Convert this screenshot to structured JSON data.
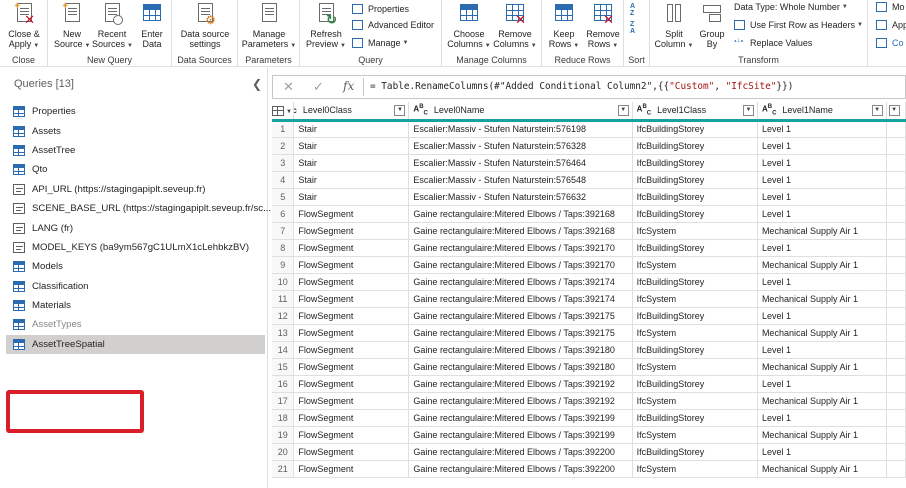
{
  "ribbon": {
    "groups": {
      "close": "Close",
      "new_query": "New Query",
      "data_sources": "Data Sources",
      "parameters": "Parameters",
      "query": "Query",
      "manage_columns": "Manage Columns",
      "reduce_rows": "Reduce Rows",
      "sort": "Sort",
      "transform": "Transform"
    },
    "buttons": {
      "close_apply": [
        "Close &",
        "Apply"
      ],
      "new_source": [
        "New",
        "Source"
      ],
      "recent_sources": [
        "Recent",
        "Sources"
      ],
      "enter_data": [
        "Enter",
        "Data"
      ],
      "data_source_settings": [
        "Data source",
        "settings"
      ],
      "manage_parameters": [
        "Manage",
        "Parameters"
      ],
      "refresh_preview": [
        "Refresh",
        "Preview"
      ],
      "properties": "Properties",
      "advanced_editor": "Advanced Editor",
      "manage": "Manage",
      "choose_columns": [
        "Choose",
        "Columns"
      ],
      "remove_columns": [
        "Remove",
        "Columns"
      ],
      "keep_rows": [
        "Keep",
        "Rows"
      ],
      "remove_rows": [
        "Remove",
        "Rows"
      ],
      "split_column": [
        "Split",
        "Column"
      ],
      "group_by": [
        "Group",
        "By"
      ],
      "data_type": "Data Type: Whole Number",
      "first_row_headers": "Use First Row as Headers",
      "replace_values": "Replace Values",
      "cut_m": "Mo",
      "cut_ap": "App",
      "cut_co": "Co"
    }
  },
  "queries": {
    "header": "Queries [13]",
    "collapse_icon": "chevron-left-icon",
    "items": [
      {
        "label": "Properties",
        "icon": "table-icon"
      },
      {
        "label": "Assets",
        "icon": "table-icon"
      },
      {
        "label": "AssetTree",
        "icon": "table-icon"
      },
      {
        "label": "Qto",
        "icon": "table-icon"
      },
      {
        "label": "API_URL (https://stagingapiplt.seveup.fr)",
        "icon": "parameter-icon"
      },
      {
        "label": "SCENE_BASE_URL (https://stagingapiplt.seveup.fr/sc...",
        "icon": "parameter-icon"
      },
      {
        "label": "LANG (fr)",
        "icon": "parameter-icon"
      },
      {
        "label": "MODEL_KEYS (ba9ym567gC1ULmX1cLehbkzBV)",
        "icon": "parameter-icon"
      },
      {
        "label": "Models",
        "icon": "table-icon"
      },
      {
        "label": "Classification",
        "icon": "table-icon"
      },
      {
        "label": "Materials",
        "icon": "table-icon"
      },
      {
        "label": "AssetTypes",
        "icon": "table-icon"
      },
      {
        "label": "AssetTreeSpatial",
        "icon": "table-icon"
      }
    ],
    "selected": "AssetTreeSpatial"
  },
  "formula_bar": {
    "cancel": "✕",
    "commit": "✓",
    "fx": "fx",
    "prefix": "= Table.RenameColumns(#\"Added Conditional Column2\",{{",
    "arg1": "\"Custom\"",
    "comma": ", ",
    "arg2": "\"IfcSite\"",
    "suffix": "}})"
  },
  "grid": {
    "columns": [
      {
        "name": "Level0Class",
        "type": "ABC"
      },
      {
        "name": "Level0Name",
        "type": "ABC"
      },
      {
        "name": "Level1Class",
        "type": "ABC"
      },
      {
        "name": "Level1Name",
        "type": "ABC"
      }
    ],
    "rows": [
      [
        "1",
        "Stair",
        "Escalier:Massiv - Stufen Naturstein:576198",
        "IfcBuildingStorey",
        "Level 1"
      ],
      [
        "2",
        "Stair",
        "Escalier:Massiv - Stufen Naturstein:576328",
        "IfcBuildingStorey",
        "Level 1"
      ],
      [
        "3",
        "Stair",
        "Escalier:Massiv - Stufen Naturstein:576464",
        "IfcBuildingStorey",
        "Level 1"
      ],
      [
        "4",
        "Stair",
        "Escalier:Massiv - Stufen Naturstein:576548",
        "IfcBuildingStorey",
        "Level 1"
      ],
      [
        "5",
        "Stair",
        "Escalier:Massiv - Stufen Naturstein:576632",
        "IfcBuildingStorey",
        "Level 1"
      ],
      [
        "6",
        "FlowSegment",
        "Gaine rectangulaire:Mitered Elbows / Taps:392168",
        "IfcBuildingStorey",
        "Level 1"
      ],
      [
        "7",
        "FlowSegment",
        "Gaine rectangulaire:Mitered Elbows / Taps:392168",
        "IfcSystem",
        "Mechanical Supply Air 1"
      ],
      [
        "8",
        "FlowSegment",
        "Gaine rectangulaire:Mitered Elbows / Taps:392170",
        "IfcBuildingStorey",
        "Level 1"
      ],
      [
        "9",
        "FlowSegment",
        "Gaine rectangulaire:Mitered Elbows / Taps:392170",
        "IfcSystem",
        "Mechanical Supply Air 1"
      ],
      [
        "10",
        "FlowSegment",
        "Gaine rectangulaire:Mitered Elbows / Taps:392174",
        "IfcBuildingStorey",
        "Level 1"
      ],
      [
        "11",
        "FlowSegment",
        "Gaine rectangulaire:Mitered Elbows / Taps:392174",
        "IfcSystem",
        "Mechanical Supply Air 1"
      ],
      [
        "12",
        "FlowSegment",
        "Gaine rectangulaire:Mitered Elbows / Taps:392175",
        "IfcBuildingStorey",
        "Level 1"
      ],
      [
        "13",
        "FlowSegment",
        "Gaine rectangulaire:Mitered Elbows / Taps:392175",
        "IfcSystem",
        "Mechanical Supply Air 1"
      ],
      [
        "14",
        "FlowSegment",
        "Gaine rectangulaire:Mitered Elbows / Taps:392180",
        "IfcBuildingStorey",
        "Level 1"
      ],
      [
        "15",
        "FlowSegment",
        "Gaine rectangulaire:Mitered Elbows / Taps:392180",
        "IfcSystem",
        "Mechanical Supply Air 1"
      ],
      [
        "16",
        "FlowSegment",
        "Gaine rectangulaire:Mitered Elbows / Taps:392192",
        "IfcBuildingStorey",
        "Level 1"
      ],
      [
        "17",
        "FlowSegment",
        "Gaine rectangulaire:Mitered Elbows / Taps:392192",
        "IfcSystem",
        "Mechanical Supply Air 1"
      ],
      [
        "18",
        "FlowSegment",
        "Gaine rectangulaire:Mitered Elbows / Taps:392199",
        "IfcBuildingStorey",
        "Level 1"
      ],
      [
        "19",
        "FlowSegment",
        "Gaine rectangulaire:Mitered Elbows / Taps:392199",
        "IfcSystem",
        "Mechanical Supply Air 1"
      ],
      [
        "20",
        "FlowSegment",
        "Gaine rectangulaire:Mitered Elbows / Taps:392200",
        "IfcBuildingStorey",
        "Level 1"
      ],
      [
        "21",
        "FlowSegment",
        "Gaine rectangulaire:Mitered Elbows / Taps:392200",
        "IfcSystem",
        "Mechanical Supply Air 1"
      ]
    ]
  },
  "colors": {
    "accent_teal": "#17a2a0",
    "highlight_red": "#d91e2a",
    "selected_bg": "#d2d0ce",
    "icon_blue": "#2b6cb0"
  }
}
